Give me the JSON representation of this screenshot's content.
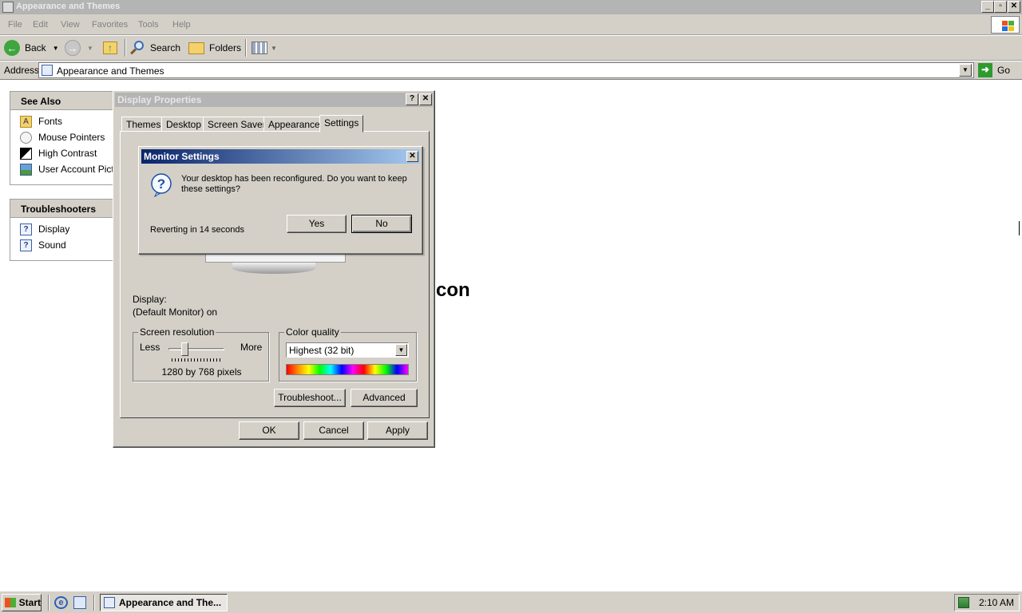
{
  "window": {
    "title": "Appearance and Themes",
    "controls": {
      "minimize": "_",
      "maximize": "▫",
      "close": "✕"
    }
  },
  "menubar": {
    "items": [
      "File",
      "Edit",
      "View",
      "Favorites",
      "Tools",
      "Help"
    ]
  },
  "toolbar": {
    "back_label": "Back",
    "search_label": "Search",
    "folders_label": "Folders"
  },
  "address": {
    "label": "Address",
    "value": "Appearance and Themes",
    "go_label": "Go"
  },
  "see_also": {
    "heading": "See Also",
    "items": [
      {
        "label": "Fonts",
        "icon": "folder-fonts-icon"
      },
      {
        "label": "Mouse Pointers",
        "icon": "mouse-icon"
      },
      {
        "label": "High Contrast",
        "icon": "contrast-icon"
      },
      {
        "label": "User Account Pictu",
        "icon": "user-picture-icon"
      }
    ]
  },
  "troubleshooters": {
    "heading": "Troubleshooters",
    "items": [
      {
        "label": "Display",
        "icon": "help-icon"
      },
      {
        "label": "Sound",
        "icon": "help-icon"
      }
    ]
  },
  "background_text": "con",
  "display_properties": {
    "title": "Display Properties",
    "help_btn": "?",
    "close_btn": "✕",
    "tabs": [
      "Themes",
      "Desktop",
      "Screen Saver",
      "Appearance",
      "Settings"
    ],
    "selected_tab": "Settings",
    "display_label": "Display:",
    "display_value": "(Default Monitor) on",
    "screen_resolution": {
      "label": "Screen resolution",
      "less": "Less",
      "more": "More",
      "value": "1280 by 768 pixels"
    },
    "color_quality": {
      "label": "Color quality",
      "selected": "Highest (32 bit)"
    },
    "troubleshoot_label": "Troubleshoot...",
    "advanced_label": "Advanced",
    "ok_label": "OK",
    "cancel_label": "Cancel",
    "apply_label": "Apply"
  },
  "monitor_settings": {
    "title": "Monitor Settings",
    "close_btn": "✕",
    "message_line1": "Your desktop has been reconfigured.  Do you want to keep",
    "message_line2": "these settings?",
    "countdown": "Reverting in 14 seconds",
    "yes_label": "Yes",
    "no_label": "No"
  },
  "taskbar": {
    "start_label": "Start",
    "task_label": "Appearance and The...",
    "clock": "2:10 AM"
  }
}
